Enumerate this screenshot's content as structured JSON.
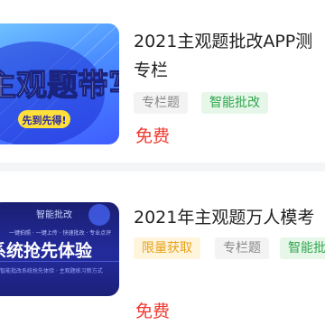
{
  "items": [
    {
      "thumb_text": "主观题带写",
      "thumb_badge": "先到先得!",
      "title_line1": "2021主观题批改APP测",
      "title_line2": "专栏",
      "tags": [
        "专栏题",
        "智能批改"
      ],
      "price": "免费"
    },
    {
      "thumb_top": "智能批改",
      "thumb_sub": "一键拍照 · 一键上传 · 快速批改 · 专业点评",
      "thumb_main": "系统抢先体验",
      "thumb_caption": "智能批改系统抢先体验 · 主观题练习新方式",
      "title": "2021年主观题万人模考",
      "tags": [
        "限量获取",
        "专栏题",
        "智能批"
      ],
      "price": "免费"
    }
  ],
  "colors": {
    "price": "#f0392f",
    "tag_green": "#2fa64d",
    "tag_yellow": "#e7a21c"
  }
}
